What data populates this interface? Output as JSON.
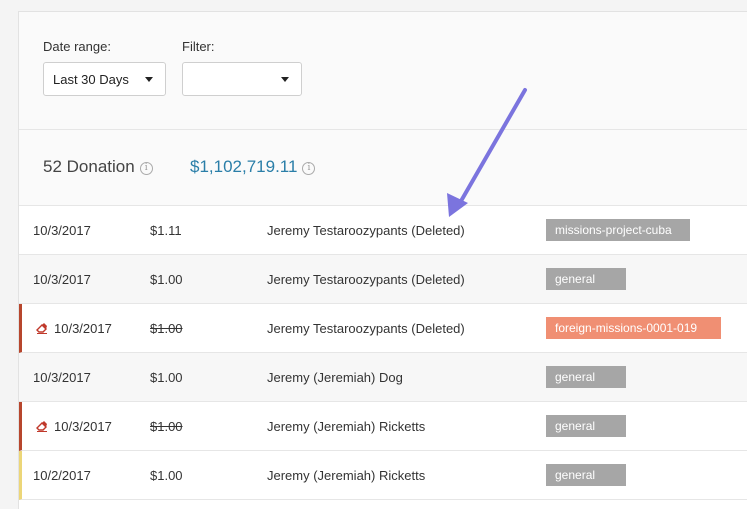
{
  "filters": {
    "date_range_label": "Date range:",
    "date_range_value": "Last 30 Days",
    "filter_label": "Filter:",
    "filter_value": ""
  },
  "summary": {
    "count_text": "52 Donation",
    "total_text": "$1,102,719.11",
    "info_glyph": "i"
  },
  "rows": [
    {
      "date": "10/3/2017",
      "amount": "$1.11",
      "name": "Jeremy Testaroozypants (Deleted)",
      "tag": "missions-project-cuba",
      "edited": false
    },
    {
      "date": "10/3/2017",
      "amount": "$1.00",
      "name": "Jeremy Testaroozypants (Deleted)",
      "tag": "general",
      "edited": false
    },
    {
      "date": "10/3/2017",
      "amount": "$1.00",
      "name": "Jeremy Testaroozypants (Deleted)",
      "tag": "foreign-missions-0001-019",
      "edited": true
    },
    {
      "date": "10/3/2017",
      "amount": "$1.00",
      "name": "Jeremy (Jeremiah) Dog",
      "tag": "general",
      "edited": false
    },
    {
      "date": "10/3/2017",
      "amount": "$1.00",
      "name": "Jeremy (Jeremiah) Ricketts",
      "tag": "general",
      "edited": true
    },
    {
      "date": "10/2/2017",
      "amount": "$1.00",
      "name": "Jeremy (Jeremiah) Ricketts",
      "tag": "general",
      "edited": false
    }
  ],
  "colors": {
    "accent_blue": "#2a7ea8",
    "tag_gray": "#a6a6a6",
    "tag_highlight": "#f08f73",
    "flag_red": "#b7462d",
    "flag_yellow": "#ecd678",
    "annotation_arrow": "#7b74de"
  }
}
